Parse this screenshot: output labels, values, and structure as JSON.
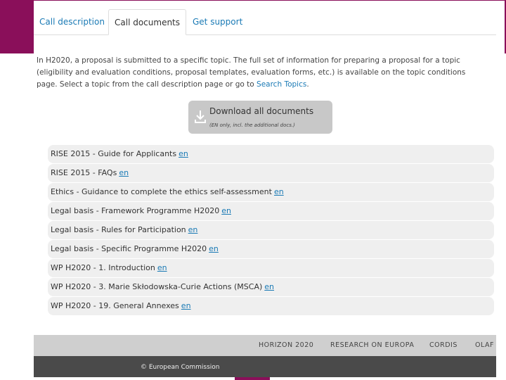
{
  "colors": {
    "accent": "#8a0f5a",
    "link": "#1a7ab5",
    "footer_bar": "#cfcfcf",
    "footer_dark": "#4a4a4a"
  },
  "tabs": [
    {
      "label": "Call description"
    },
    {
      "label": "Call documents",
      "active": true
    },
    {
      "label": "Get support"
    }
  ],
  "intro": {
    "text": "In H2020, a proposal is submitted to a specific topic. The full set of information for preparing a proposal for a topic (eligibility and evaluation conditions, proposal templates, evaluation forms, etc.) is available on the topic conditions page. Select a topic from the call description page or go to ",
    "link": "Search Topics",
    "end": "."
  },
  "download": {
    "icon": "download-icon",
    "title": "Download all documents",
    "subtitle": "(EN only, incl. the additional docs.)"
  },
  "documents": [
    {
      "name": "RISE 2015 - Guide for Applicants",
      "lang": "en"
    },
    {
      "name": "RISE 2015 - FAQs",
      "lang": "en"
    },
    {
      "name": "Ethics - Guidance to complete the ethics self-assessment",
      "lang": "en"
    },
    {
      "name": "Legal basis - Framework Programme H2020",
      "lang": "en"
    },
    {
      "name": "Legal basis - Rules for Participation",
      "lang": "en"
    },
    {
      "name": "Legal basis - Specific Programme H2020",
      "lang": "en"
    },
    {
      "name": "WP H2020 - 1. Introduction",
      "lang": "en"
    },
    {
      "name": "WP H2020 - 3. Marie Skłodowska-Curie Actions (MSCA)",
      "lang": "en"
    },
    {
      "name": "WP H2020 - 19. General Annexes",
      "lang": "en"
    }
  ],
  "footer": {
    "links": [
      "HORIZON 2020",
      "RESEARCH ON EUROPA",
      "CORDIS",
      "OLAF"
    ],
    "copyright": "© European Commission"
  }
}
